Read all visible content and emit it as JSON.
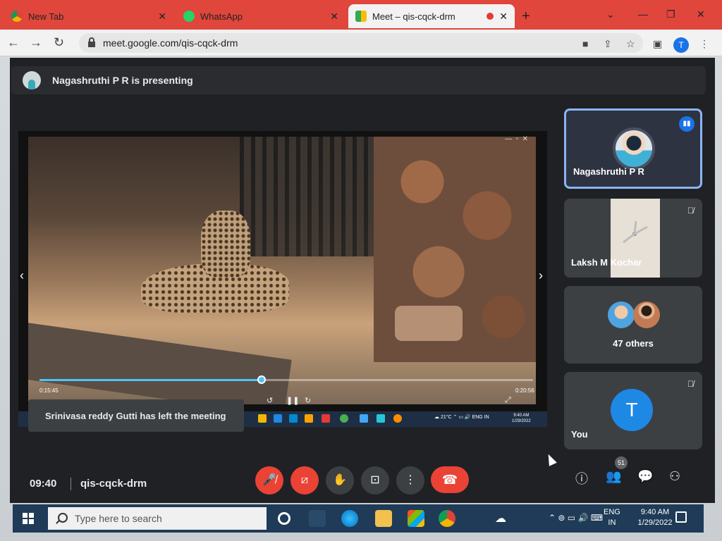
{
  "browser": {
    "tabs": [
      {
        "label": "New Tab",
        "icon": "chrome-icon"
      },
      {
        "label": "WhatsApp",
        "icon": "whatsapp-icon"
      },
      {
        "label": "Meet – qis-cqck-drm",
        "icon": "meet-icon",
        "active": true
      }
    ],
    "new_tab_symbol": "+",
    "url": "meet.google.com/qis-cqck-drm",
    "profile_initial": "T"
  },
  "meet": {
    "presenting_text": "Nagashruthi P R is presenting",
    "shared_screen": {
      "elapsed": "0:15:45",
      "duration": "0:20:56",
      "progress": 0.45,
      "inner_taskbar": {
        "temperature": "21°C",
        "lang": "ENG IN",
        "time": "9:40 AM",
        "date": "1/29/2022"
      }
    },
    "toast": "Srinivasa reddy Gutti has left the meeting",
    "participants": [
      {
        "name": "Nagashruthi P R",
        "speaking": true
      },
      {
        "name": "Laksh M Kochar",
        "muted": true
      },
      {
        "name": "47 others"
      },
      {
        "name": "You",
        "initial": "T",
        "muted": true
      }
    ],
    "bottom_bar": {
      "time": "09:40",
      "code": "qis-cqck-drm",
      "people_count": "51"
    }
  },
  "taskbar": {
    "search_placeholder": "Type here to search",
    "lang_line1": "ENG",
    "lang_line2": "IN",
    "time": "9:40 AM",
    "date": "1/29/2022"
  },
  "colors": {
    "tabbar": "#e0463c",
    "meet_bg": "#202124",
    "accent_blue": "#8ab4f8",
    "end_call_red": "#ea4335",
    "taskbar": "#1f3b57"
  }
}
